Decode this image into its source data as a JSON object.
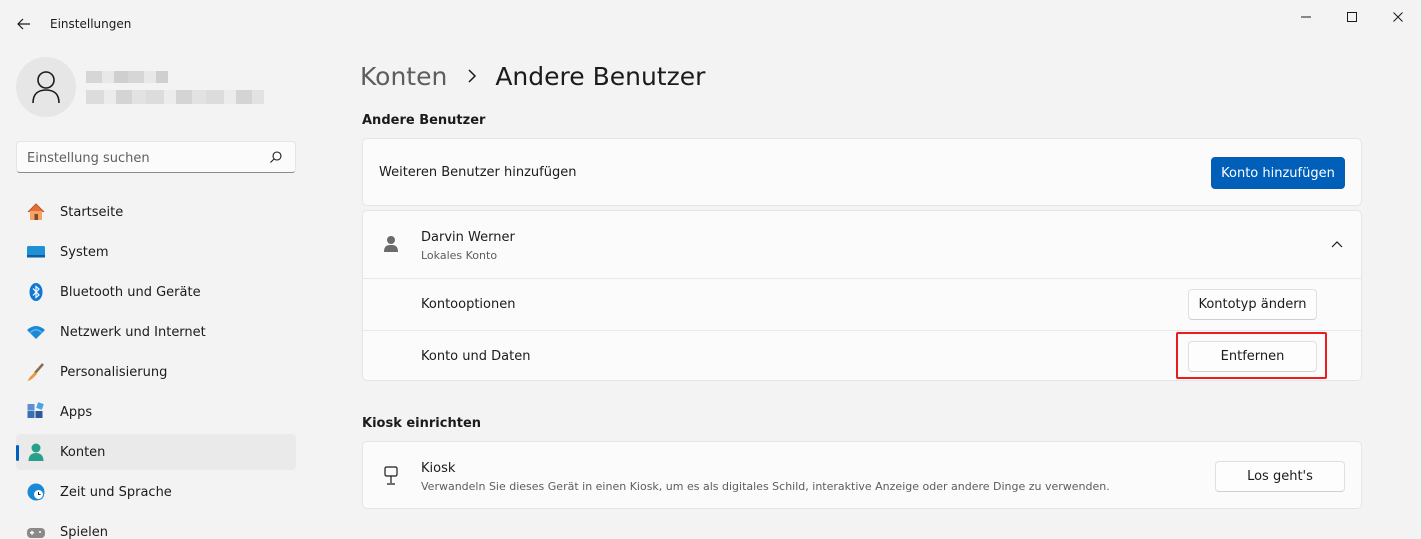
{
  "app": {
    "title": "Einstellungen"
  },
  "search": {
    "placeholder": "Einstellung suchen"
  },
  "sidebar": {
    "items": [
      {
        "label": "Startseite",
        "icon": "home-icon"
      },
      {
        "label": "System",
        "icon": "system-monitor-icon"
      },
      {
        "label": "Bluetooth und Geräte",
        "icon": "bluetooth-icon"
      },
      {
        "label": "Netzwerk und Internet",
        "icon": "wifi-icon"
      },
      {
        "label": "Personalisierung",
        "icon": "brush-icon"
      },
      {
        "label": "Apps",
        "icon": "apps-icon"
      },
      {
        "label": "Konten",
        "icon": "person-icon",
        "active": true
      },
      {
        "label": "Zeit und Sprache",
        "icon": "clock-globe-icon"
      },
      {
        "label": "Spielen",
        "icon": "gamepad-icon"
      }
    ]
  },
  "breadcrumb": {
    "parent": "Konten",
    "current": "Andere Benutzer"
  },
  "other_users": {
    "section_title": "Andere Benutzer",
    "add_label": "Weiteren Benutzer hinzufügen",
    "add_button": "Konto hinzufügen",
    "user": {
      "name": "Darvin Werner",
      "type": "Lokales Konto"
    },
    "account_options_label": "Kontooptionen",
    "change_type_button": "Kontotyp ändern",
    "account_data_label": "Konto und Daten",
    "remove_button": "Entfernen"
  },
  "kiosk": {
    "section_title": "Kiosk einrichten",
    "title": "Kiosk",
    "description": "Verwandeln Sie dieses Gerät in einen Kiosk, um es als digitales Schild, interaktive Anzeige oder andere Dinge zu verwenden.",
    "button": "Los geht's"
  },
  "colors": {
    "accent": "#005fb8",
    "highlight": "#e81e1e",
    "background": "#f3f3f3"
  }
}
